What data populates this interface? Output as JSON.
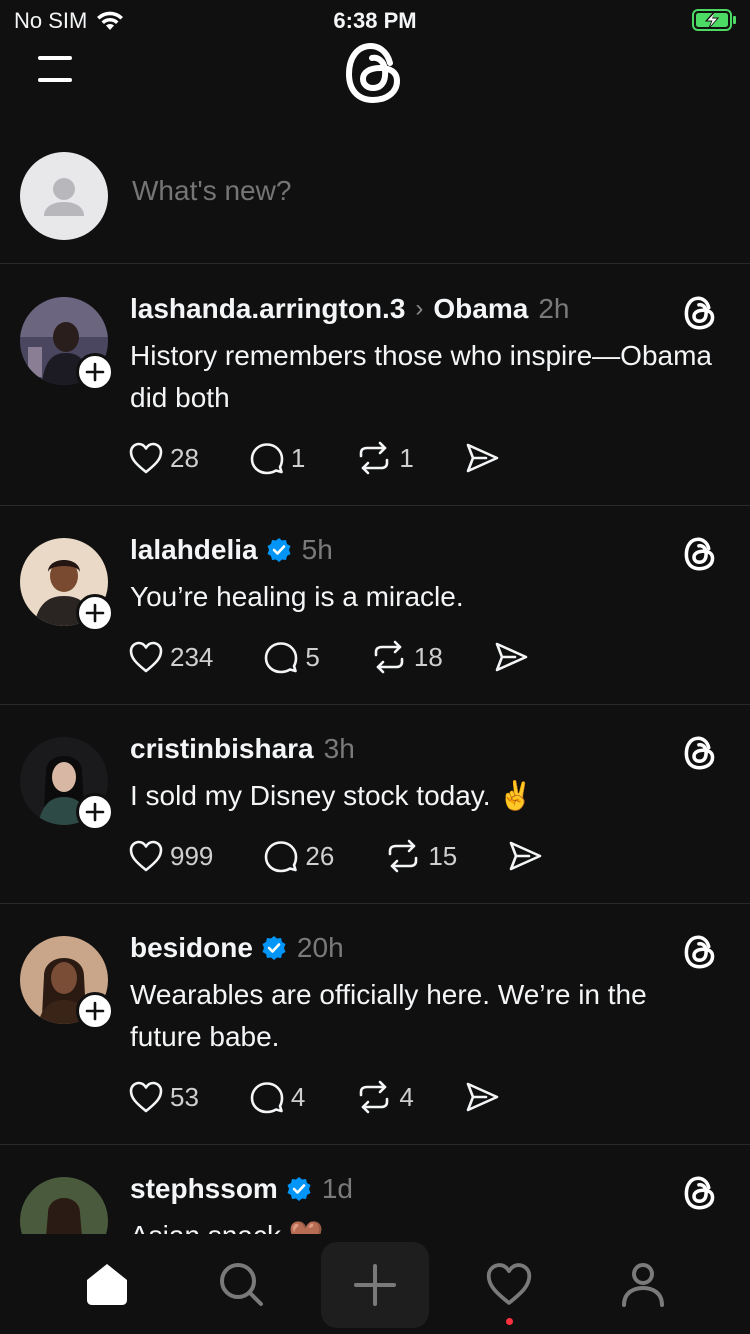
{
  "status_bar": {
    "carrier": "No SIM",
    "time": "6:38 PM"
  },
  "composer": {
    "placeholder": "What's new?"
  },
  "posts": [
    {
      "username": "lashanda.arrington.3",
      "thread": "Obama",
      "time": "2h",
      "verified": false,
      "text": "History remembers those who inspire—Obama did both",
      "likes": "28",
      "replies": "1",
      "reposts": "1"
    },
    {
      "username": "lalahdelia",
      "time": "5h",
      "verified": true,
      "text": "You’re healing is a miracle.",
      "likes": "234",
      "replies": "5",
      "reposts": "18"
    },
    {
      "username": "cristinbishara",
      "time": "3h",
      "verified": false,
      "text": "I sold my Disney stock today. ✌️",
      "likes": "999",
      "replies": "26",
      "reposts": "15"
    },
    {
      "username": "besidone",
      "time": "20h",
      "verified": true,
      "text": "Wearables are officially here. We’re in the future babe.",
      "likes": "53",
      "replies": "4",
      "reposts": "4"
    },
    {
      "username": "stephssom",
      "time": "1d",
      "verified": true,
      "text": "Asian snack 🤎"
    }
  ],
  "colors": {
    "background": "#101010",
    "verified": "#0095f6",
    "notification_dot": "#ff3040",
    "battery": "#4cd964"
  },
  "icons": [
    "menu-icon",
    "threads-logo-icon",
    "heart-icon",
    "comment-icon",
    "repost-icon",
    "share-icon",
    "home-icon",
    "search-icon",
    "plus-icon",
    "profile-icon"
  ]
}
